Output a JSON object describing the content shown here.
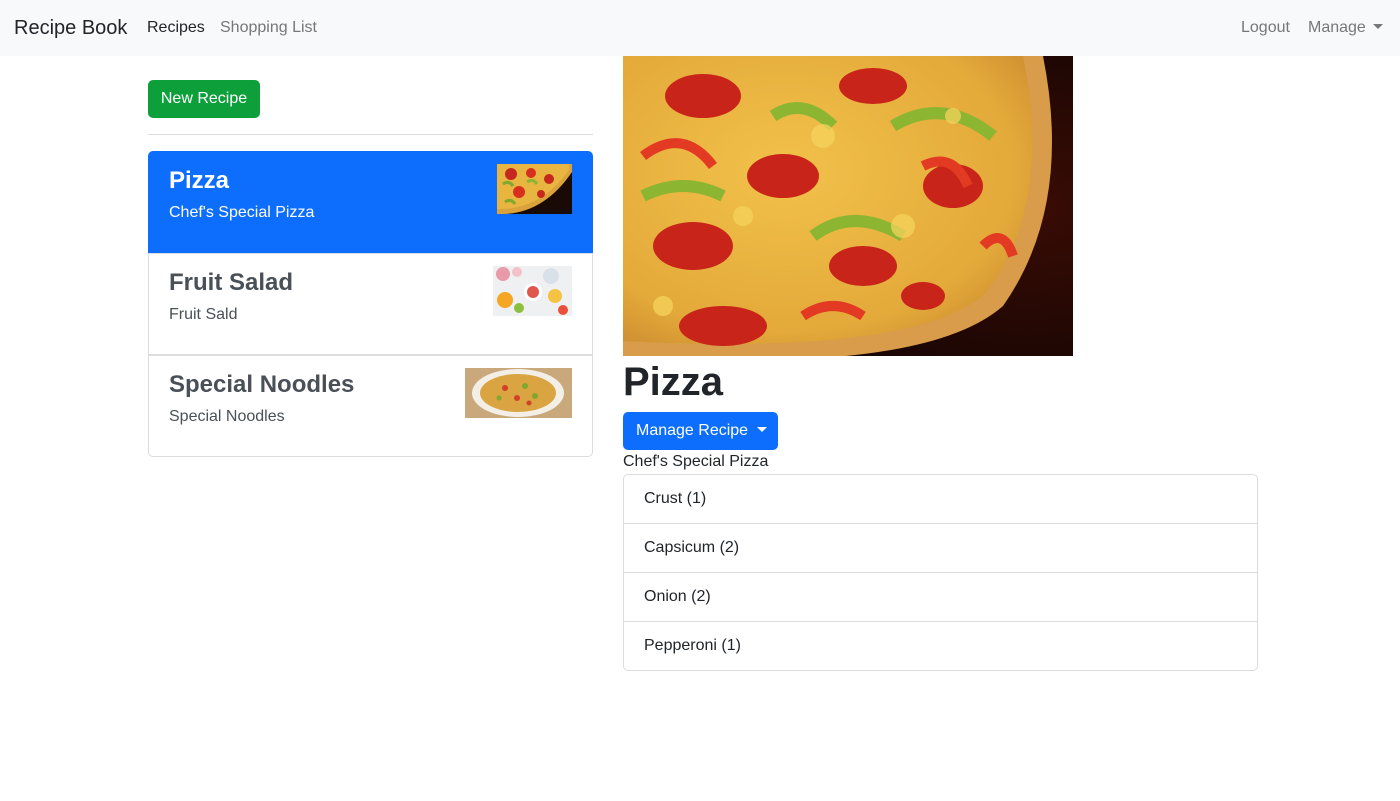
{
  "navbar": {
    "brand": "Recipe Book",
    "links": [
      {
        "label": "Recipes",
        "active": true
      },
      {
        "label": "Shopping List",
        "active": false
      }
    ],
    "logout_label": "Logout",
    "manage_label": "Manage"
  },
  "sidebar": {
    "new_recipe_label": "New Recipe",
    "recipes": [
      {
        "name": "Pizza",
        "description": "Chef's Special Pizza",
        "active": true
      },
      {
        "name": "Fruit Salad",
        "description": "Fruit Sald",
        "active": false
      },
      {
        "name": "Special Noodles",
        "description": "Special Noodles",
        "active": false
      }
    ]
  },
  "detail": {
    "title": "Pizza",
    "manage_button_label": "Manage Recipe",
    "description": "Chef's Special Pizza",
    "ingredients": [
      {
        "label": "Crust (1)"
      },
      {
        "label": "Capsicum (2)"
      },
      {
        "label": "Onion (2)"
      },
      {
        "label": "Pepperoni (1)"
      }
    ]
  },
  "colors": {
    "primary": "#0d6efd",
    "success": "#0d9f3a",
    "navbar_bg": "#f8f9fa",
    "border": "#dcdcdc"
  }
}
